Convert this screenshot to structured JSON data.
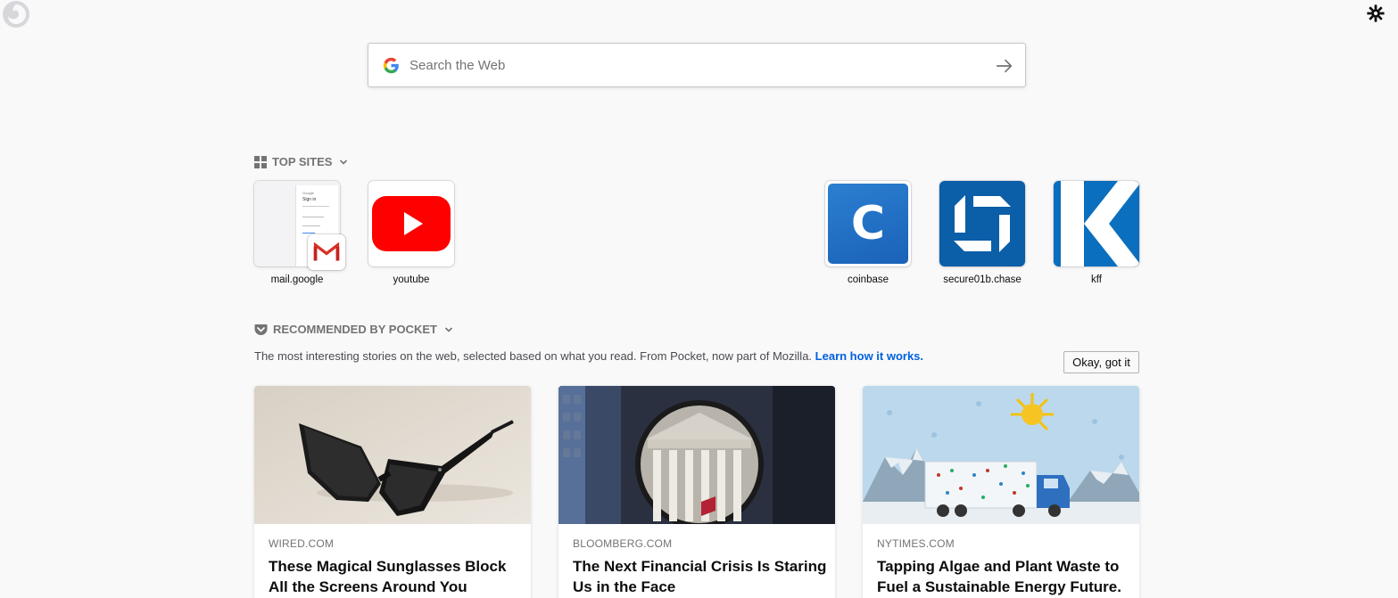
{
  "search": {
    "placeholder": "Search the Web"
  },
  "top_sites": {
    "title": "TOP SITES",
    "sites": [
      {
        "label": "mail.google",
        "icon": "gmail-icon"
      },
      {
        "label": "youtube",
        "icon": "youtube-icon"
      },
      {
        "label": "coinbase",
        "icon": "coinbase-icon"
      },
      {
        "label": "secure01b.chase",
        "icon": "chase-icon"
      },
      {
        "label": "kff",
        "icon": "kff-icon"
      }
    ],
    "gmail_preview": {
      "brand": "Google",
      "heading": "Sign in"
    },
    "coinbase_letter": "C"
  },
  "pocket": {
    "title": "RECOMMENDED BY POCKET",
    "description": "The most interesting stories on the web, selected based on what you read. From Pocket, now part of Mozilla.",
    "learn_link": "Learn how it works.",
    "okay_button": "Okay, got it",
    "cards": [
      {
        "source": "WIRED.COM",
        "title": "These Magical Sunglasses Block All the Screens Around You"
      },
      {
        "source": "BLOOMBERG.COM",
        "title": "The Next Financial Crisis Is Staring Us in the Face"
      },
      {
        "source": "NYTIMES.COM",
        "title": "Tapping Algae and Plant Waste to Fuel a Sustainable Energy Future."
      }
    ]
  },
  "colors": {
    "background": "#f9f9fa",
    "link": "#0060df",
    "youtube_red": "#ff0000",
    "coinbase_blue": "#1652f0",
    "chase_blue": "#0b5ea8",
    "kff_blue": "#0a6fbe"
  }
}
